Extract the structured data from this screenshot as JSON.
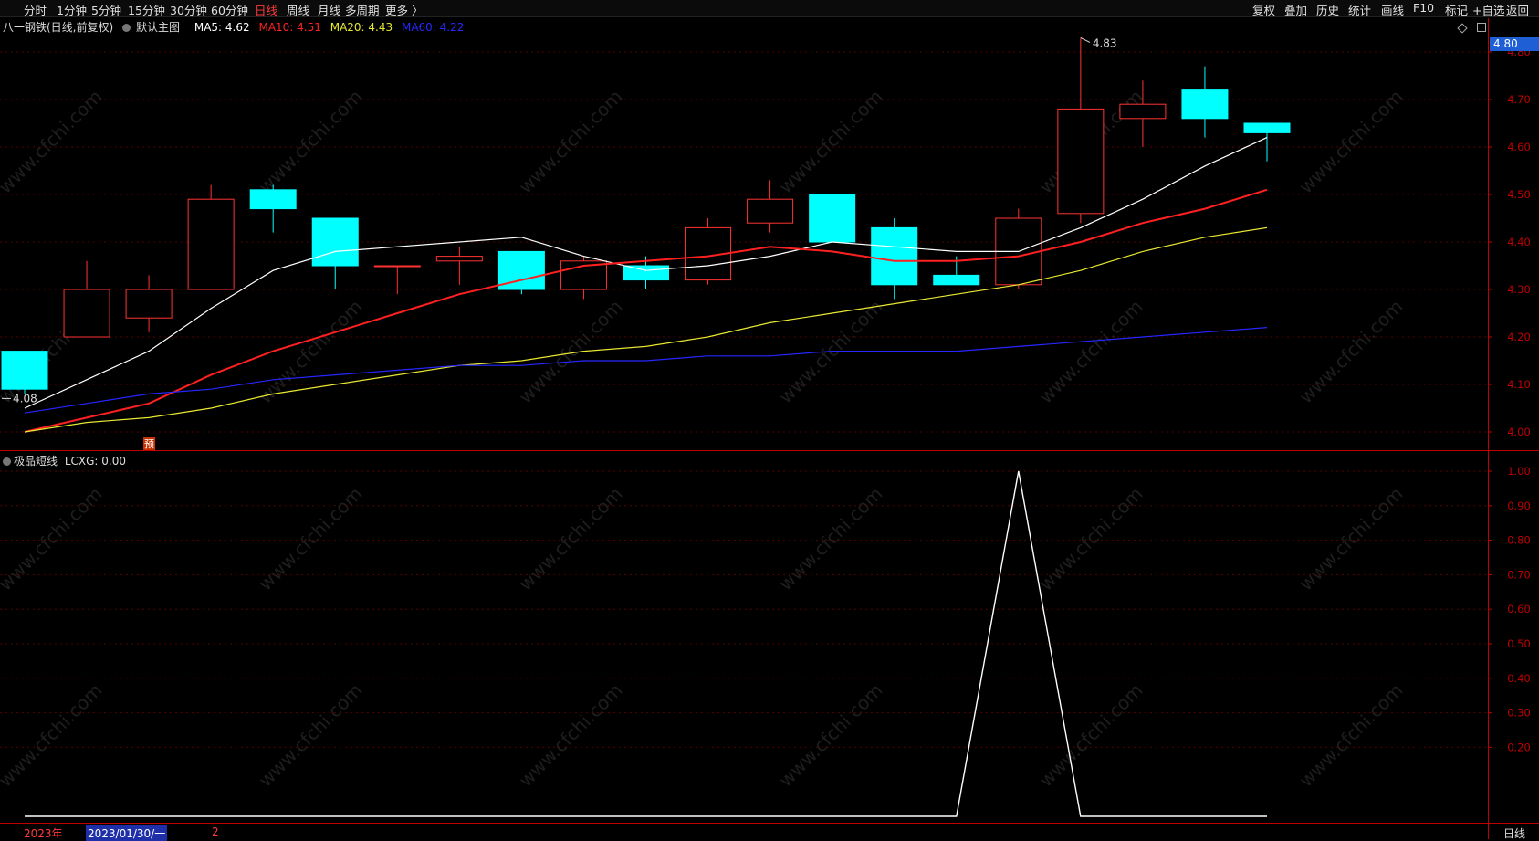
{
  "toolbar": {
    "left": [
      "分时",
      "1分钟",
      "5分钟",
      "15分钟",
      "30分钟",
      "60分钟",
      "日线",
      "周线",
      "月线",
      "多周期",
      "更多 〉"
    ],
    "active": "日线",
    "right": [
      "复权",
      "叠加",
      "历史",
      "统计",
      "画线",
      "F10",
      "标记",
      "+自选",
      "返回"
    ]
  },
  "main_legend": {
    "title": "八一钢铁(日线,前复权)",
    "indicator": "默认主图",
    "ma5": "MA5: 4.62",
    "ma10": "MA10: 4.51",
    "ma20": "MA20: 4.43",
    "ma60": "MA60: 4.22"
  },
  "sub_legend": {
    "indicator": "极品短线",
    "value": "LCXG: 0.00"
  },
  "price_tag": "4.80",
  "bottom": {
    "year": "2023年",
    "date": "2023/01/30/一",
    "marker": "2",
    "period": "日线"
  },
  "watermark": "www.cfchi.com",
  "yu_badge": "预",
  "colors": {
    "up": "#ff3232",
    "down": "#00ffff",
    "ma5": "#ffffff",
    "ma10": "#ff2020",
    "ma20": "#e8e832",
    "ma60": "#2626ff",
    "grid": "#5a0000",
    "axis": "#c00000"
  },
  "chart_data": [
    {
      "type": "candlestick",
      "title": "八一钢铁(日线,前复权)",
      "ylim": [
        3.98,
        4.83
      ],
      "y_ticks": [
        "4.00",
        "4.10",
        "4.20",
        "4.30",
        "4.40",
        "4.50",
        "4.60",
        "4.70",
        "4.80"
      ],
      "annotations": [
        {
          "text": "4.83",
          "kind": "high"
        },
        {
          "text": "4.08",
          "kind": "low"
        }
      ],
      "candles": [
        {
          "o": 4.17,
          "h": 4.17,
          "l": 4.08,
          "c": 4.09
        },
        {
          "o": 4.2,
          "h": 4.36,
          "l": 4.2,
          "c": 4.3
        },
        {
          "o": 4.24,
          "h": 4.33,
          "l": 4.21,
          "c": 4.3
        },
        {
          "o": 4.3,
          "h": 4.52,
          "l": 4.3,
          "c": 4.49
        },
        {
          "o": 4.51,
          "h": 4.52,
          "l": 4.42,
          "c": 4.47
        },
        {
          "o": 4.45,
          "h": 4.45,
          "l": 4.3,
          "c": 4.35
        },
        {
          "o": 4.35,
          "h": 4.35,
          "l": 4.29,
          "c": 4.35
        },
        {
          "o": 4.36,
          "h": 4.39,
          "l": 4.31,
          "c": 4.37
        },
        {
          "o": 4.38,
          "h": 4.38,
          "l": 4.29,
          "c": 4.3
        },
        {
          "o": 4.3,
          "h": 4.37,
          "l": 4.28,
          "c": 4.36
        },
        {
          "o": 4.35,
          "h": 4.37,
          "l": 4.3,
          "c": 4.32
        },
        {
          "o": 4.32,
          "h": 4.45,
          "l": 4.31,
          "c": 4.43
        },
        {
          "o": 4.44,
          "h": 4.53,
          "l": 4.42,
          "c": 4.49
        },
        {
          "o": 4.5,
          "h": 4.5,
          "l": 4.4,
          "c": 4.4
        },
        {
          "o": 4.43,
          "h": 4.45,
          "l": 4.28,
          "c": 4.31
        },
        {
          "o": 4.33,
          "h": 4.37,
          "l": 4.31,
          "c": 4.31
        },
        {
          "o": 4.31,
          "h": 4.47,
          "l": 4.3,
          "c": 4.45
        },
        {
          "o": 4.46,
          "h": 4.83,
          "l": 4.44,
          "c": 4.68
        },
        {
          "o": 4.66,
          "h": 4.74,
          "l": 4.6,
          "c": 4.69
        },
        {
          "o": 4.72,
          "h": 4.77,
          "l": 4.62,
          "c": 4.66
        },
        {
          "o": 4.65,
          "h": 4.65,
          "l": 4.57,
          "c": 4.63
        }
      ],
      "series": [
        {
          "name": "MA5",
          "values": [
            4.05,
            4.11,
            4.17,
            4.26,
            4.34,
            4.38,
            4.39,
            4.4,
            4.41,
            4.37,
            4.34,
            4.35,
            4.37,
            4.4,
            4.39,
            4.38,
            4.38,
            4.43,
            4.49,
            4.56,
            4.62
          ]
        },
        {
          "name": "MA10",
          "values": [
            4.0,
            4.03,
            4.06,
            4.12,
            4.17,
            4.21,
            4.25,
            4.29,
            4.32,
            4.35,
            4.36,
            4.37,
            4.39,
            4.38,
            4.36,
            4.36,
            4.37,
            4.4,
            4.44,
            4.47,
            4.51
          ]
        },
        {
          "name": "MA20",
          "values": [
            4.0,
            4.02,
            4.03,
            4.05,
            4.08,
            4.1,
            4.12,
            4.14,
            4.15,
            4.17,
            4.18,
            4.2,
            4.23,
            4.25,
            4.27,
            4.29,
            4.31,
            4.34,
            4.38,
            4.41,
            4.43
          ]
        },
        {
          "name": "MA60",
          "values": [
            4.04,
            4.06,
            4.08,
            4.09,
            4.11,
            4.12,
            4.13,
            4.14,
            4.14,
            4.15,
            4.15,
            4.16,
            4.16,
            4.17,
            4.17,
            4.17,
            4.18,
            4.19,
            4.2,
            4.21,
            4.22
          ]
        }
      ]
    },
    {
      "type": "line",
      "title": "极品短线",
      "ylim": [
        0,
        1.0
      ],
      "y_ticks": [
        "0.20",
        "0.30",
        "0.40",
        "0.50",
        "0.60",
        "0.70",
        "0.80",
        "0.90",
        "1.00"
      ],
      "series": [
        {
          "name": "LCXG",
          "values": [
            0,
            0,
            0,
            0,
            0,
            0,
            0,
            0,
            0,
            0,
            0,
            0,
            0,
            0,
            0,
            0,
            1,
            0,
            0,
            0,
            0
          ]
        }
      ]
    }
  ]
}
